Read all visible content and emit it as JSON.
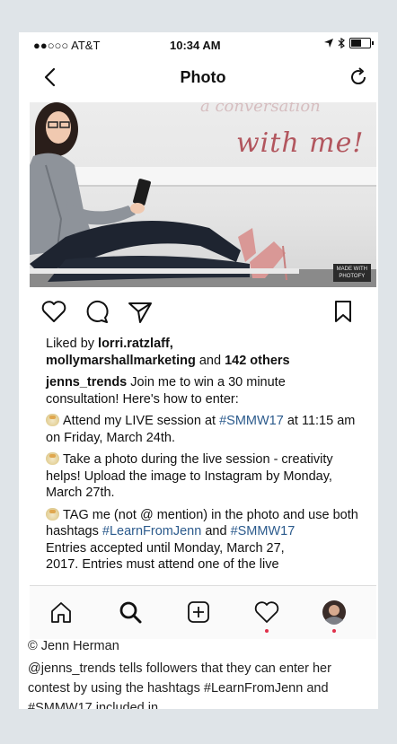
{
  "status": {
    "carrier": "●●○○○ AT&T",
    "time": "10:34 AM"
  },
  "nav": {
    "title": "Photo"
  },
  "photo": {
    "headline": "with me!",
    "faded_text": "a conversation",
    "badge_line1": "MADE WITH",
    "badge_line2": "PHOTOFY"
  },
  "likes": {
    "prefix": "Liked by ",
    "user1": "lorri.ratzlaff,",
    "user2": "mollymarshallmarketing",
    "middle": " and ",
    "count": "142 others"
  },
  "caption": {
    "username": "jenns_trends",
    "intro": " Join me to win a 30 minute consultation! Here's how to enter:",
    "step1_a": "Attend my LIVE session at ",
    "step1_tag": "#SMMW17",
    "step1_b": " at 11:15 am on Friday, March 24th.",
    "step2": "Take a photo during the live session - creativity helps! Upload the image to Instagram by Monday, March 27th.",
    "step3_a": "TAG me (not @ mention) in the photo and use both hashtags ",
    "step3_tag1": "#LearnFromJenn",
    "step3_and": " and ",
    "step3_tag2": "#SMMW17",
    "entries": "Entries accepted until Monday, March 27,",
    "cut": "2017. Entries must attend one of the live"
  },
  "credit": "© Jenn Herman",
  "description": "@jenns_trends tells followers that they can enter her contest by using the hashtags #LearnFromJenn and #SMMW17 included in..."
}
